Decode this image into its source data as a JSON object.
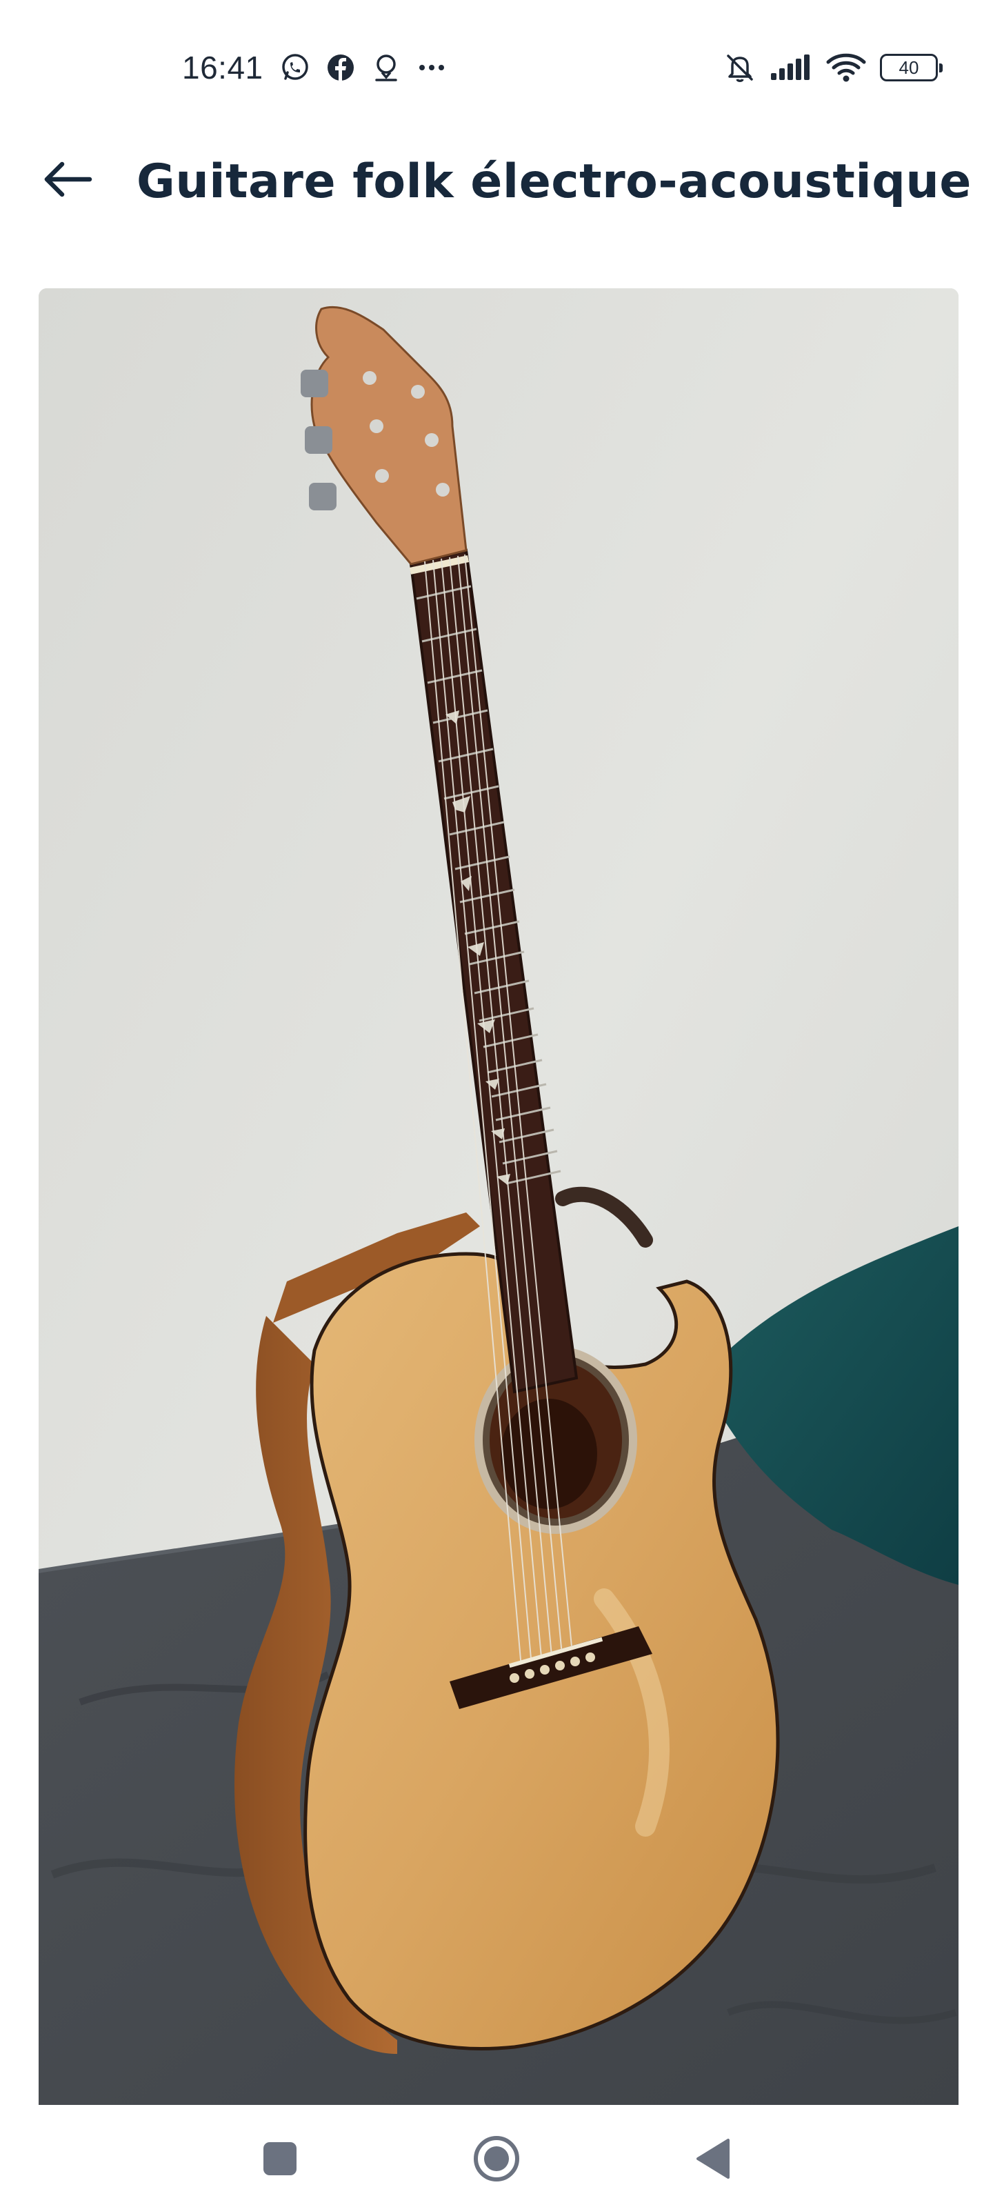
{
  "status_bar": {
    "time": "16:41",
    "battery_level": "40",
    "left_icons": [
      "whatsapp-icon",
      "facebook-icon",
      "location-icon",
      "more-icon"
    ],
    "right_icons": [
      "bell-muted-icon",
      "signal-icon",
      "wifi-icon",
      "battery-icon"
    ]
  },
  "header": {
    "title": "Guitare folk électro-acoustique",
    "back_icon": "arrow-left-icon"
  },
  "photo": {
    "subject": "acoustic-guitar-photo"
  },
  "nav_bar": {
    "buttons": [
      "recents-square-icon",
      "home-circle-icon",
      "back-triangle-icon"
    ]
  },
  "colors": {
    "title": "#17283b",
    "status": "#1f2937",
    "background": "#ffffff",
    "nav_icons": "#6b7280"
  }
}
